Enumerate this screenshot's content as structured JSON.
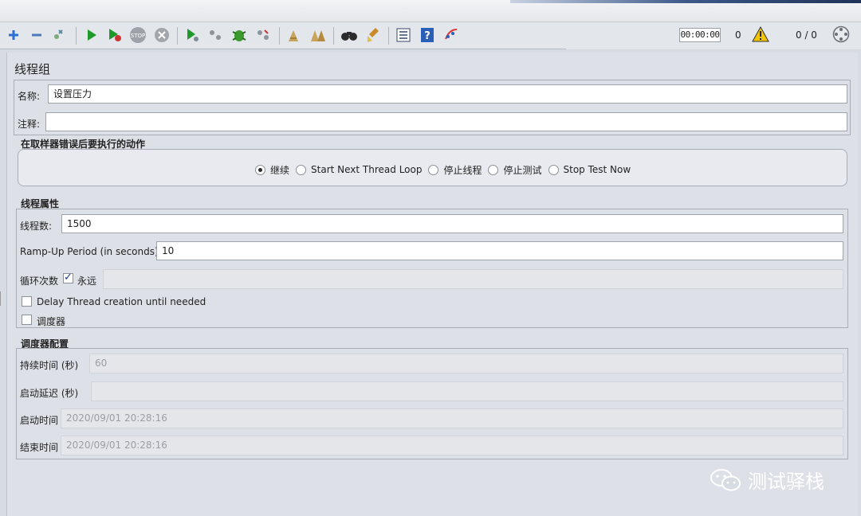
{
  "toolbar": {
    "timer": "00:00:00",
    "warning_count": "0",
    "thread_ratio": "0 / 0",
    "icons": [
      "add-icon",
      "remove-icon",
      "clear-icon",
      "start-icon",
      "start-no-pause-icon",
      "stop-icon",
      "shutdown-icon",
      "remote-start-icon",
      "remote-stop-icon",
      "remote-shutdown-icon",
      "remote-exit-icon",
      "clear-icon",
      "clear-all-icon",
      "search-icon",
      "reset-search-icon",
      "function-helper-icon",
      "help-icon",
      "log-viewer-icon",
      "warning-icon",
      "threads-indicator-icon"
    ]
  },
  "panel": {
    "title": "线程组",
    "name_label": "名称:",
    "name_value": "设置压力",
    "comment_label": "注释:",
    "comment_value": ""
  },
  "error_action": {
    "heading": "在取样器错误后要执行的动作",
    "options": [
      "继续",
      "Start Next Thread Loop",
      "停止线程",
      "停止测试",
      "Stop Test Now"
    ],
    "selected": "继续"
  },
  "thread_props": {
    "heading": "线程属性",
    "threads_label": "线程数:",
    "threads_value": "1500",
    "rampup_label": "Ramp-Up Period (in seconds):",
    "rampup_value": "10",
    "loop_label": "循环次数",
    "forever_label": "永远",
    "forever_checked": true,
    "delay_label": "Delay Thread creation until needed",
    "delay_checked": false,
    "scheduler_label": "调度器",
    "scheduler_checked": false
  },
  "scheduler": {
    "heading": "调度器配置",
    "duration_label": "持续时间 (秒)",
    "duration_value": "60",
    "startup_delay_label": "启动延迟 (秒)",
    "startup_delay_value": "",
    "start_time_label": "启动时间",
    "start_time_value": "2020/09/01 20:28:16",
    "end_time_label": "结束时间",
    "end_time_value": "2020/09/01 20:28:16"
  },
  "watermark": {
    "text": "测试驿栈"
  }
}
